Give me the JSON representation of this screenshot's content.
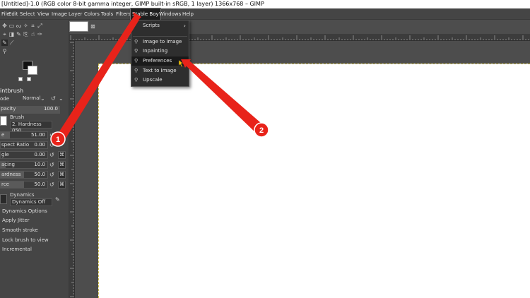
{
  "window": {
    "title": "[Untitled]-1.0 (RGB color 8-bit gamma integer, GIMP built-in sRGB, 1 layer) 1366x768 – GIMP"
  },
  "menubar": {
    "items": [
      "File",
      "Edit",
      "Select",
      "View",
      "Image",
      "Layer",
      "Colors",
      "Tools",
      "Filters",
      "Stable Boy",
      "Windows",
      "Help"
    ],
    "active": "Stable Boy"
  },
  "dropdown": {
    "items": [
      {
        "label": "Scripts",
        "has_submenu": true
      },
      {
        "label": "Image to Image",
        "icon": "plugin-icon"
      },
      {
        "label": "Inpainting",
        "icon": "plugin-icon"
      },
      {
        "label": "Preferences",
        "icon": "plugin-icon",
        "highlighted": true
      },
      {
        "label": "Text to Image",
        "icon": "plugin-icon"
      },
      {
        "label": "Upscale",
        "icon": "plugin-icon"
      }
    ]
  },
  "tool_options": {
    "title": "intbrush",
    "mode_label": "ode",
    "mode_value": "Normal",
    "opacity_label": "pacity",
    "opacity_value": "100.0",
    "brush_label": "Brush",
    "brush_value": "2. Hardness 050",
    "size_label": "e",
    "size_value": "51.00",
    "aspect_label": "spect Ratio",
    "aspect_value": "0.00",
    "angle_label": "gle",
    "angle_value": "0.00",
    "spacing_label": "acing",
    "spacing_value": "10.0",
    "hardness_label": "ardness",
    "hardness_value": "50.0",
    "force_label": "rce",
    "force_value": "50.0",
    "dynamics_label": "Dynamics",
    "dynamics_value": "Dynamics Off",
    "checks": [
      "Dynamics Options",
      "Apply Jitter",
      "Smooth stroke",
      "Lock brush to view",
      "Incremental"
    ]
  },
  "annotations": {
    "callout_1": "1",
    "callout_2": "2",
    "arrow_color": "#e8231a"
  }
}
